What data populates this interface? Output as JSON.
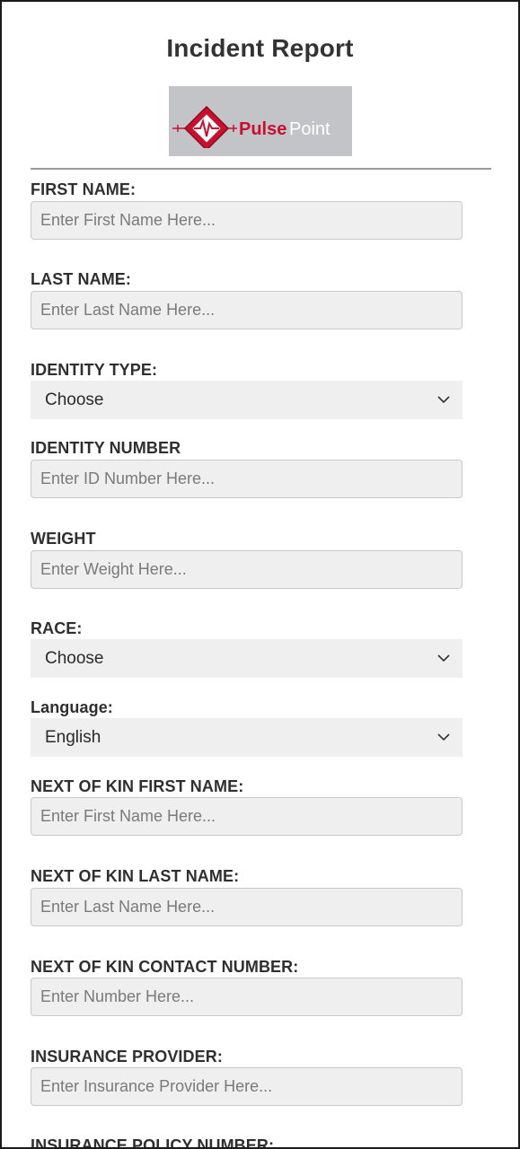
{
  "header": {
    "title": "Incident Report"
  },
  "logo": {
    "brand_text_1": "Pulse",
    "brand_text_2": "Point",
    "accent_color": "#c8102e",
    "background_color": "#c3c4c8",
    "icon": "heartbeat-logo-icon"
  },
  "form": {
    "first_name": {
      "label": "FIRST NAME:",
      "placeholder": "Enter First Name Here..."
    },
    "last_name": {
      "label": "LAST NAME:",
      "placeholder": "Enter Last Name Here..."
    },
    "identity_type": {
      "label": "IDENTITY TYPE:",
      "value": "Choose"
    },
    "identity_number": {
      "label": "IDENTITY NUMBER",
      "placeholder": "Enter ID Number Here..."
    },
    "weight": {
      "label": "WEIGHT",
      "placeholder": "Enter Weight Here..."
    },
    "race": {
      "label": "RACE:",
      "value": "Choose"
    },
    "language": {
      "label": "Language:",
      "value": "English"
    },
    "kin_first_name": {
      "label": "NEXT OF KIN FIRST NAME:",
      "placeholder": "Enter First Name Here..."
    },
    "kin_last_name": {
      "label": "NEXT OF KIN LAST NAME:",
      "placeholder": "Enter Last Name Here..."
    },
    "kin_contact": {
      "label": "NEXT OF KIN CONTACT NUMBER:",
      "placeholder": "Enter Number Here..."
    },
    "insurance_provider": {
      "label": "INSURANCE PROVIDER:",
      "placeholder": "Enter Insurance Provider Here..."
    },
    "insurance_policy": {
      "label": "INSURANCE POLICY NUMBER:"
    }
  }
}
